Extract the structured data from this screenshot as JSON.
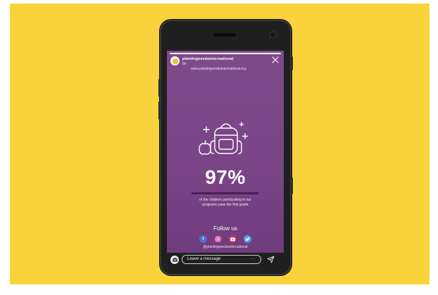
{
  "colors": {
    "background": "#f8d33c",
    "story_purple": "#7a4486",
    "accent_bar": "#4d1f58",
    "facebook": "#4a73c9",
    "instagram": "#b23a8a",
    "youtube": "#d42f5b",
    "twitter": "#4da3e3"
  },
  "story": {
    "account_name": "plantingseedsinternational",
    "time_ago": "6h",
    "website": "www.plantingseedsinternational.org",
    "progress": 1.0,
    "stat_value": "97%",
    "stat_caption_line1": "of the children participating in our",
    "stat_caption_line2": "programs pass the first grade",
    "follow_label": "Follow us",
    "socials": [
      "facebook-icon",
      "instagram-icon",
      "youtube-icon",
      "twitter-icon"
    ],
    "handle": "@plantingseedsinternational"
  },
  "reply": {
    "placeholder": "Leave a message",
    "more": "···"
  }
}
